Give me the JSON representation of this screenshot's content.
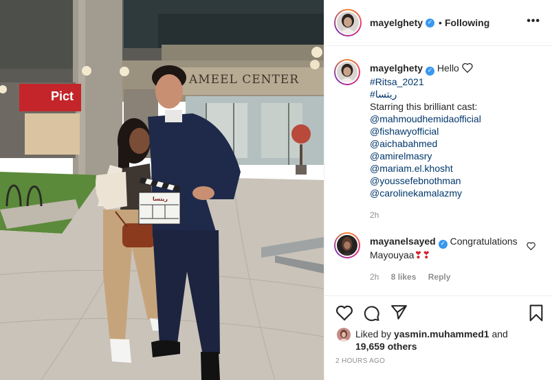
{
  "photo": {
    "building_sign": "AMEEL  CENTER",
    "shop_sign": "Pict",
    "slate_title": "ريتسا"
  },
  "post": {
    "author": "mayelghety",
    "follow_status": "Following",
    "separator": "•",
    "more_label": "•••"
  },
  "caption": {
    "author": "mayelghety",
    "text": "Hello",
    "lines": [
      "#Ritsa_2021",
      "#ريتسا",
      "Starring this brilliant cast:",
      "@mahmoudhemidaofficial",
      "@fishawyofficial",
      "@aichabahmed",
      "@amirelmasry",
      "@mariam.el.khosht",
      "@youssefebnothman",
      "@carolinekamalazmy"
    ],
    "time": "2h"
  },
  "comment": {
    "author": "mayanelsayed",
    "text": "Congratulations",
    "text2": "Mayouyaa",
    "hearts": "❣❣",
    "time": "2h",
    "likes": "8 likes",
    "reply": "Reply"
  },
  "likes": {
    "prefix": "Liked by",
    "user": "yasmin.muhammed1",
    "and": "and",
    "others": "19,659 others"
  },
  "timestamp": "2 HOURS AGO",
  "icons": {
    "like": "heart-icon",
    "comment": "comment-icon",
    "share": "share-icon",
    "save": "bookmark-icon"
  },
  "colors": {
    "link": "#00376b",
    "verified": "#3897f0",
    "muted": "#8e8e8e",
    "text": "#262626"
  }
}
